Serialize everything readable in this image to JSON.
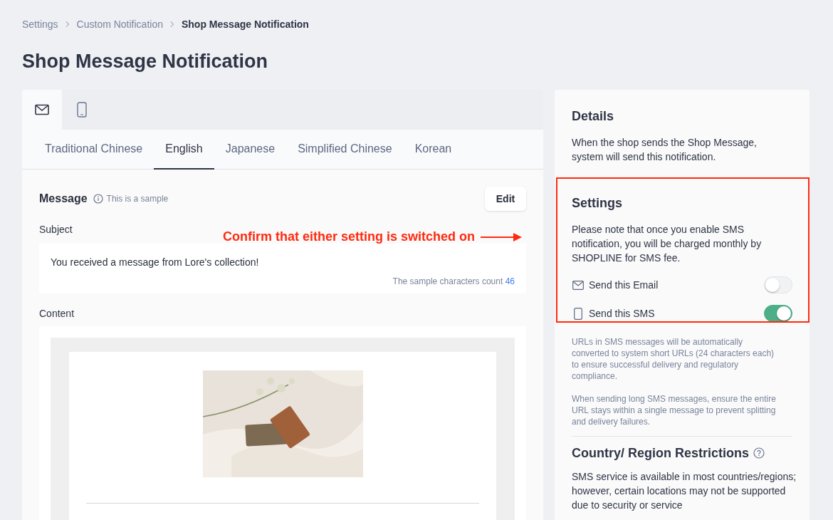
{
  "breadcrumb": [
    {
      "label": "Settings",
      "current": false
    },
    {
      "label": "Custom Notification",
      "current": false
    },
    {
      "label": "Shop Message Notification",
      "current": true
    }
  ],
  "page_title": "Shop Message Notification",
  "channel_tabs": [
    {
      "kind": "email",
      "selected": true
    },
    {
      "kind": "sms",
      "selected": false
    }
  ],
  "language_tabs": [
    {
      "label": "Traditional Chinese",
      "selected": false
    },
    {
      "label": "English",
      "selected": true
    },
    {
      "label": "Japanese",
      "selected": false
    },
    {
      "label": "Simplified Chinese",
      "selected": false
    },
    {
      "label": "Korean",
      "selected": false
    }
  ],
  "message": {
    "title": "Message",
    "hint": "This is a sample",
    "edit_button": "Edit",
    "subject_label": "Subject",
    "subject": "You received a message from Lore's collection!",
    "count_label": "The sample characters count",
    "count": "46",
    "content_label": "Content"
  },
  "details": {
    "title": "Details",
    "text": "When the shop sends the Shop Message, system will send this notification."
  },
  "settings": {
    "title": "Settings",
    "text": "Please note that once you enable SMS notification, you will be charged monthly by SHOPLINE for SMS fee.",
    "toggles": [
      {
        "kind": "email",
        "label": "Send this Email",
        "on": false
      },
      {
        "kind": "sms",
        "label": "Send this SMS",
        "on": true
      }
    ],
    "notes": [
      "URLs in SMS messages will be automatically converted to system short URLs (24 characters each) to ensure successful delivery and regulatory compliance.",
      "When sending long SMS messages, ensure the entire URL stays within a single message to prevent splitting and delivery failures."
    ]
  },
  "restrictions": {
    "title": "Country/ Region Restrictions",
    "text": "SMS service is available in most countries/regions; however, certain locations may not be supported due to security or service"
  },
  "annotation": {
    "text": "Confirm that either setting is switched on"
  }
}
